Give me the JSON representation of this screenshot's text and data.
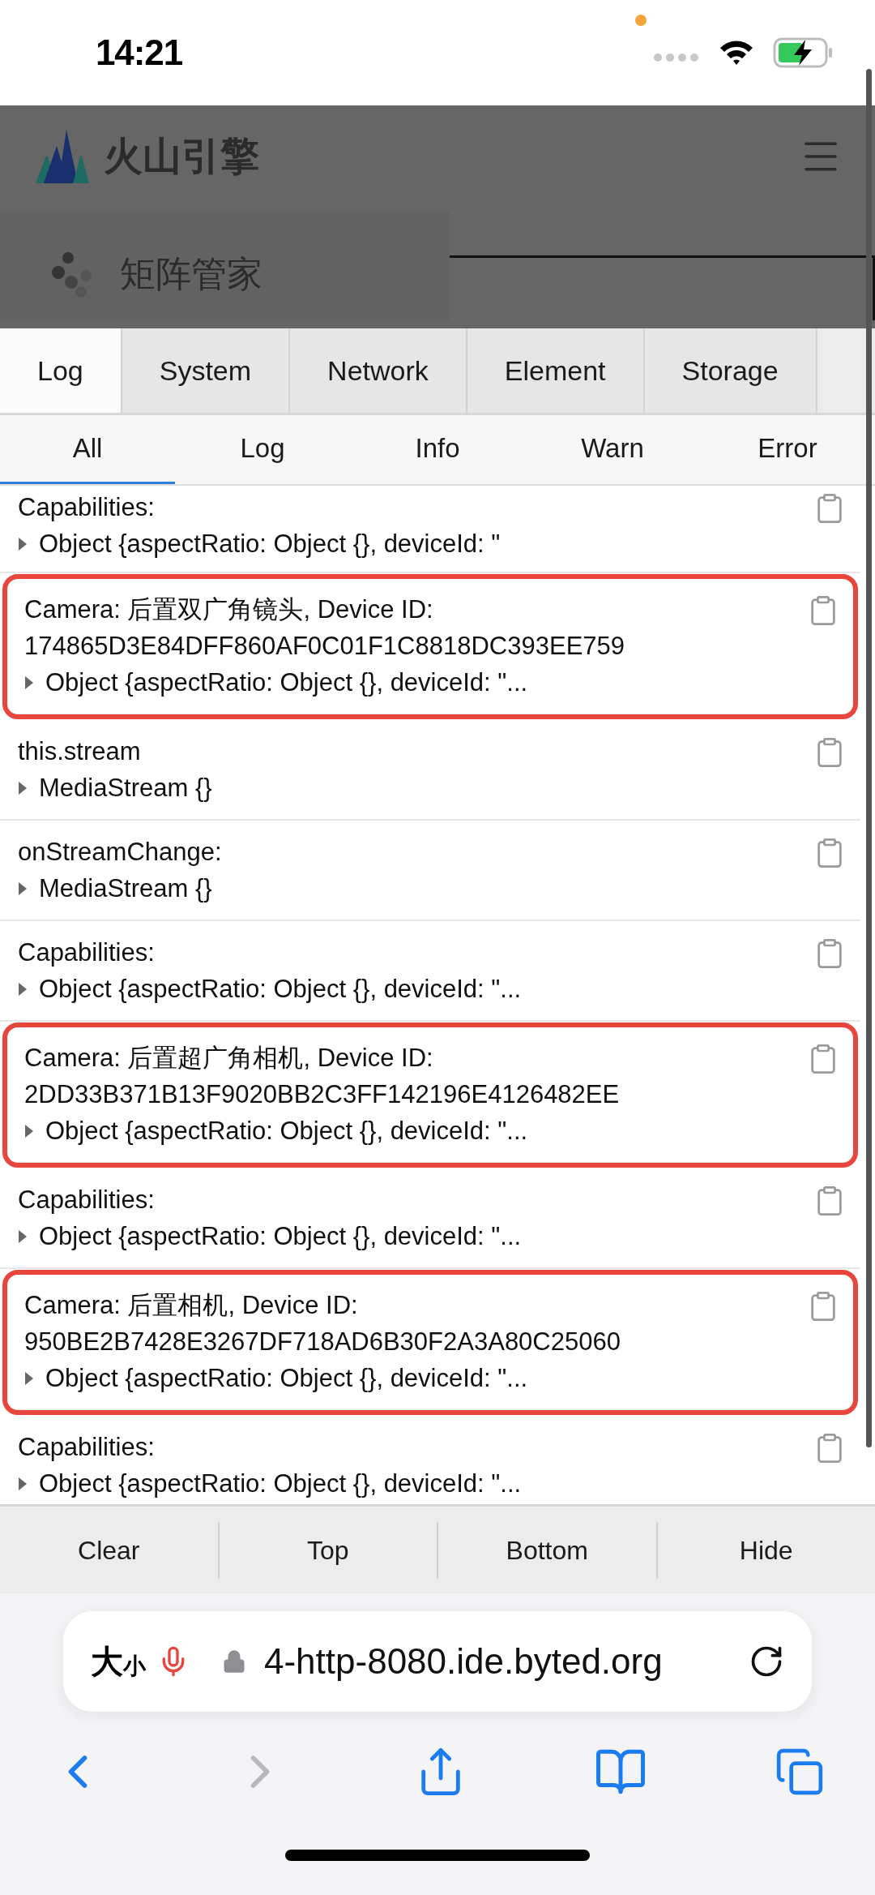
{
  "status_bar": {
    "time": "14:21"
  },
  "site_header": {
    "brand": "火山引擎",
    "product": "矩阵管家"
  },
  "console": {
    "tabs": [
      {
        "label": "Log",
        "selected": true
      },
      {
        "label": "System",
        "selected": false
      },
      {
        "label": "Network",
        "selected": false
      },
      {
        "label": "Element",
        "selected": false
      },
      {
        "label": "Storage",
        "selected": false
      }
    ],
    "filters": [
      {
        "label": "All",
        "selected": true
      },
      {
        "label": "Log",
        "selected": false
      },
      {
        "label": "Info",
        "selected": false
      },
      {
        "label": "Warn",
        "selected": false
      },
      {
        "label": "Error",
        "selected": false
      }
    ],
    "entries": [
      {
        "message": "Capabilities:",
        "value": "Object {aspectRatio: Object {}, deviceId: \"",
        "highlighted": false
      },
      {
        "message": "Camera: 后置双广角镜头, Device ID: 174865D3E84DFF860AF0C01F1C8818DC393EE759",
        "value": "Object {aspectRatio: Object {}, deviceId: \"...",
        "highlighted": true
      },
      {
        "message": "this.stream",
        "value": "MediaStream {}",
        "highlighted": false
      },
      {
        "message": "onStreamChange:",
        "value": "MediaStream {}",
        "highlighted": false
      },
      {
        "message": "Capabilities:",
        "value": "Object {aspectRatio: Object {}, deviceId: \"...",
        "highlighted": false
      },
      {
        "message": "Camera: 后置超广角相机, Device ID: 2DD33B371B13F9020BB2C3FF142196E4126482EE",
        "value": "Object {aspectRatio: Object {}, deviceId: \"...",
        "highlighted": true
      },
      {
        "message": "Capabilities:",
        "value": "Object {aspectRatio: Object {}, deviceId: \"...",
        "highlighted": false
      },
      {
        "message": "Camera: 后置相机, Device ID: 950BE2B7428E3267DF718AD6B30F2A3A80C25060",
        "value": "Object {aspectRatio: Object {}, deviceId: \"...",
        "highlighted": true
      },
      {
        "message": "Capabilities:",
        "value": "Object {aspectRatio: Object {}, deviceId: \"...",
        "highlighted": false
      }
    ],
    "actions": [
      "Clear",
      "Top",
      "Bottom",
      "Hide"
    ]
  },
  "browser": {
    "text_size": [
      "大",
      "小"
    ],
    "url": "4-http-8080.ide.byted.org",
    "back_disabled": false,
    "forward_disabled": true
  }
}
